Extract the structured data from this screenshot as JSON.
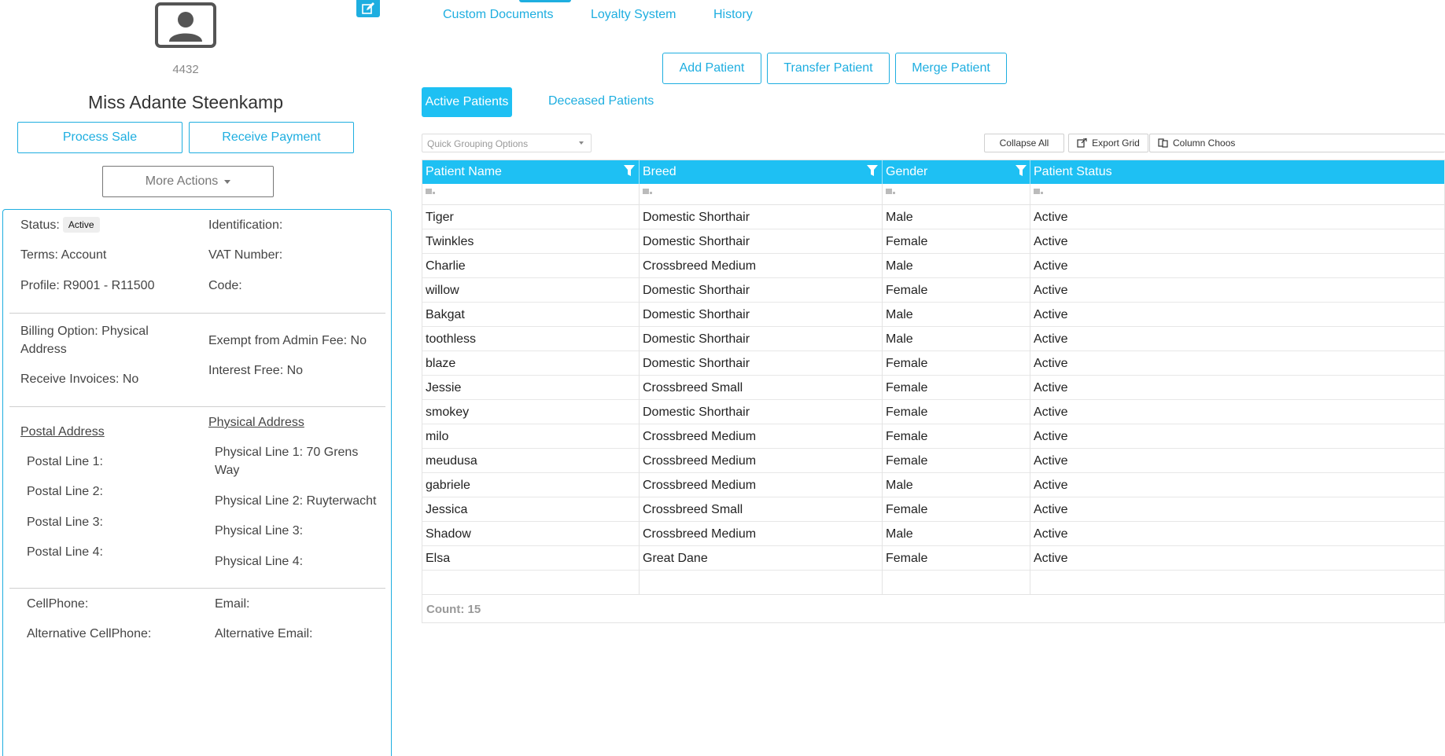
{
  "client": {
    "id": "4432",
    "name": "Miss Adante Steenkamp",
    "process_sale_label": "Process Sale",
    "receive_payment_label": "Receive Payment",
    "more_actions_label": "More Actions",
    "status_label": "Status:",
    "status_value": "Active",
    "identification_label": "Identification:",
    "terms_text": "Terms: Account",
    "vat_label": "VAT Number:",
    "profile_text": "Profile: R9001 - R11500",
    "code_label": "Code:",
    "billing_line1": "Billing Option: Physical",
    "billing_line2": "Address",
    "exempt_text": "Exempt from Admin Fee: No",
    "interest_text": "Interest Free: No",
    "receive_invoices_text": "Receive Invoices: No",
    "postal_header": "Postal Address",
    "physical_header": "Physical Address",
    "postal_line1": "Postal Line 1:",
    "postal_line2": "Postal Line 2:",
    "postal_line3": "Postal Line 3:",
    "postal_line4": "Postal Line 4:",
    "physical_line1a": "Physical Line 1: 70 Grens",
    "physical_line1b": "Way",
    "physical_line2": "Physical Line 2: Ruyterwacht",
    "physical_line3": "Physical Line 3:",
    "physical_line4": "Physical Line 4:",
    "cellphone_label": "CellPhone:",
    "email_label": "Email:",
    "alt_cellphone_label": "Alternative CellPhone:",
    "alt_email_label": "Alternative Email:"
  },
  "tabs": {
    "custom_documents": "Custom Documents",
    "loyalty_system": "Loyalty System",
    "history": "History"
  },
  "actions": {
    "add_patient": "Add Patient",
    "transfer_patient": "Transfer Patient",
    "merge_patient": "Merge Patient"
  },
  "subtabs": {
    "active": "Active Patients",
    "deceased": "Deceased Patients"
  },
  "toolbar": {
    "grouping_placeholder": "Quick Grouping Options",
    "collapse_all": "Collapse All",
    "export_grid": "Export Grid",
    "column_chooser": "Column Choos"
  },
  "grid": {
    "columns": [
      "Patient Name",
      "Breed",
      "Gender",
      "Patient Status"
    ],
    "rows": [
      [
        "Tiger",
        "Domestic Shorthair",
        "Male",
        "Active"
      ],
      [
        "Twinkles",
        "Domestic Shorthair",
        "Female",
        "Active"
      ],
      [
        "Charlie",
        "Crossbreed Medium",
        "Male",
        "Active"
      ],
      [
        "willow",
        "Domestic Shorthair",
        "Female",
        "Active"
      ],
      [
        "Bakgat",
        "Domestic Shorthair",
        "Male",
        "Active"
      ],
      [
        "toothless",
        "Domestic Shorthair",
        "Male",
        "Active"
      ],
      [
        "blaze",
        "Domestic Shorthair",
        "Female",
        "Active"
      ],
      [
        "Jessie",
        "Crossbreed Small",
        "Female",
        "Active"
      ],
      [
        "smokey",
        "Domestic Shorthair",
        "Female",
        "Active"
      ],
      [
        "milo",
        "Crossbreed Medium",
        "Female",
        "Active"
      ],
      [
        "meudusa",
        "Crossbreed Medium",
        "Female",
        "Active"
      ],
      [
        "gabriele",
        "Crossbreed Medium",
        "Male",
        "Active"
      ],
      [
        "Jessica",
        "Crossbreed Small",
        "Female",
        "Active"
      ],
      [
        "Shadow",
        "Crossbreed Medium",
        "Male",
        "Active"
      ],
      [
        "Elsa",
        "Great Dane",
        "Female",
        "Active"
      ]
    ],
    "count_text": "Count: 15"
  },
  "colors": {
    "accent": "#1eaee0",
    "header_bg": "#1ec0f3"
  }
}
